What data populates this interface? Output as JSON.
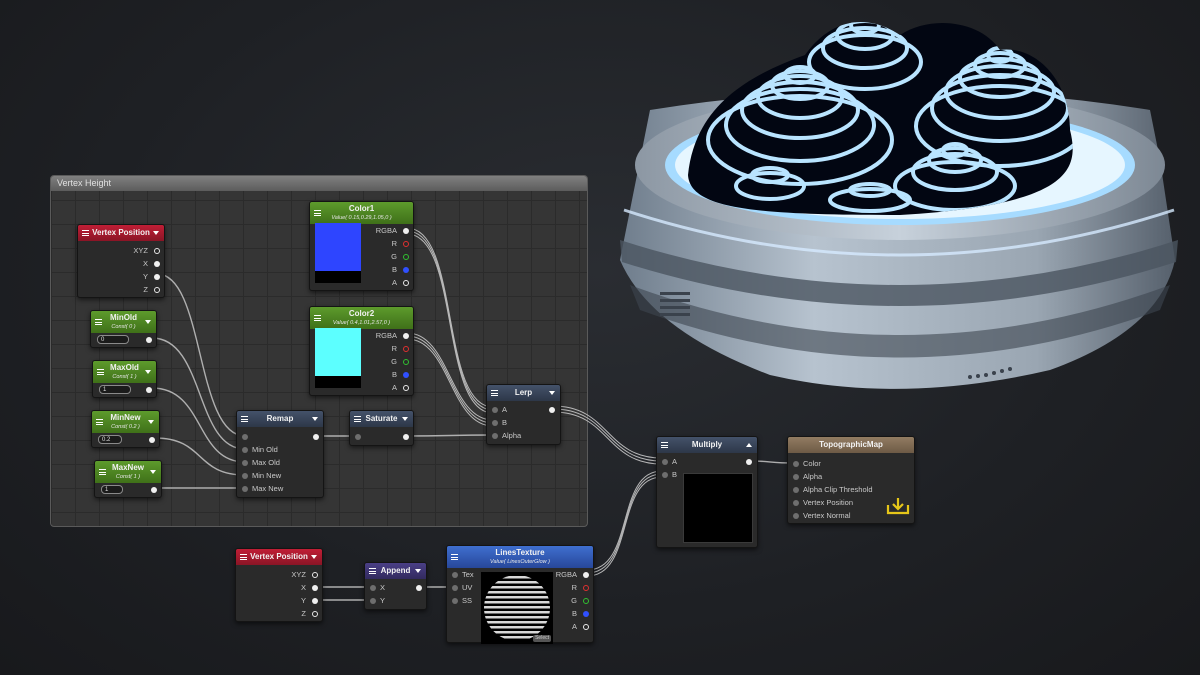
{
  "group": {
    "title": "Vertex Height"
  },
  "nodes": {
    "vertex_position_1": {
      "title": "Vertex Position",
      "outputs": [
        "XYZ",
        "X",
        "Y",
        "Z"
      ]
    },
    "min_old": {
      "title": "MinOld",
      "subtitle": "Const( 0 )",
      "value": "0"
    },
    "max_old": {
      "title": "MaxOld",
      "subtitle": "Const( 1 )",
      "value": "1"
    },
    "min_new": {
      "title": "MinNew",
      "subtitle": "Const( 0.2 )",
      "value": "0.2"
    },
    "max_new": {
      "title": "MaxNew",
      "subtitle": "Const( 1 )",
      "value": "1"
    },
    "color1": {
      "title": "Color1",
      "subtitle": "Value( 0.15,0.29,1.05,0 )",
      "outputs": [
        "RGBA",
        "R",
        "G",
        "B",
        "A"
      ],
      "swatch": "#2e45ff"
    },
    "color2": {
      "title": "Color2",
      "subtitle": "Value( 0.4,1.01,2.57,0 )",
      "outputs": [
        "RGBA",
        "R",
        "G",
        "B",
        "A"
      ],
      "swatch": "#5cffff"
    },
    "remap": {
      "title": "Remap",
      "inputs": [
        "Min Old",
        "Max Old",
        "Min New",
        "Max New"
      ]
    },
    "saturate": {
      "title": "Saturate"
    },
    "lerp": {
      "title": "Lerp",
      "inputs": [
        "A",
        "B",
        "Alpha"
      ]
    },
    "multiply": {
      "title": "Multiply",
      "inputs": [
        "A",
        "B"
      ]
    },
    "topographic_map": {
      "title": "TopographicMap",
      "inputs": [
        "Color",
        "Alpha",
        "Alpha Clip Threshold",
        "Vertex Position",
        "Vertex Normal"
      ]
    },
    "vertex_position_2": {
      "title": "Vertex Position",
      "outputs": [
        "XYZ",
        "X",
        "Y",
        "Z"
      ]
    },
    "append": {
      "title": "Append",
      "inputs": [
        "X",
        "Y"
      ]
    },
    "lines_texture": {
      "title": "LinesTexture",
      "subtitle": "Value( LinesOuterGlow )",
      "inputs": [
        "Tex",
        "UV",
        "SS"
      ],
      "outputs": [
        "RGBA",
        "R",
        "G",
        "B",
        "A"
      ],
      "button": "Select"
    }
  },
  "colors": {
    "pin_red": "#e03030",
    "pin_green": "#30c030",
    "pin_blue": "#3050ff",
    "accent_gold": "#e6c619"
  }
}
